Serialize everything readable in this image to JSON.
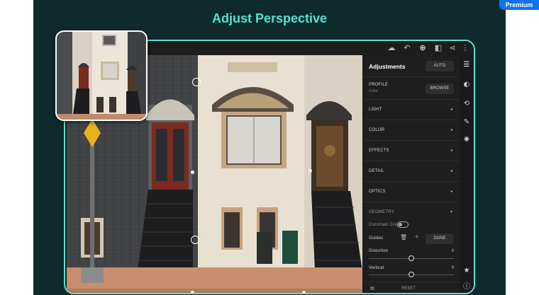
{
  "premium_badge": "Premium",
  "headline": "Adjust Perspective",
  "toolbar": {
    "icons": [
      "cloud-icon",
      "undo-icon",
      "add-icon",
      "compare-icon",
      "share-icon",
      "more-icon"
    ]
  },
  "panel": {
    "title": "Adjustments",
    "auto_label": "AUTO",
    "profile_label": "PROFILE",
    "profile_value": "Color",
    "browse_label": "BROWSE",
    "sections": [
      "LIGHT",
      "COLOR",
      "EFFECTS",
      "DETAIL",
      "OPTICS",
      "GEOMETRY"
    ],
    "constrain_crop_label": "Constrain Crop",
    "guides_label": "Guides",
    "done_label": "DONE",
    "distortion_label": "Distortion",
    "distortion_value": "0",
    "vertical_label": "Vertical",
    "vertical_value": "0",
    "reset_label": "RESET"
  },
  "rail": {
    "icons": [
      "sliders-icon",
      "heal-icon",
      "crop-rotate-icon",
      "brush-icon",
      "filter-icon",
      "star-icon",
      "info-icon"
    ]
  },
  "colors": {
    "accent": "#4fe3d3",
    "background": "#0f2a2c",
    "premium": "#1473e6",
    "panel": "#1e1e1e"
  }
}
